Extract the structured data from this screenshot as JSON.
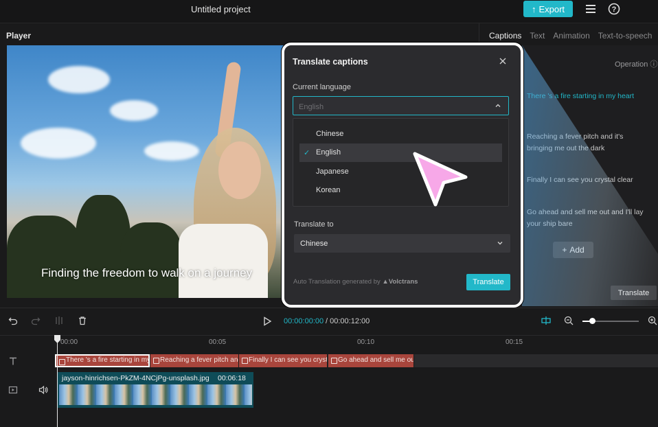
{
  "app": {
    "project_title": "Untitled project",
    "export_label": "Export",
    "colors": {
      "accent": "#22b8c9",
      "caption_clip": "#a8453c",
      "video_clip": "#0f4c58",
      "cursor": "#f7a8e8"
    }
  },
  "player": {
    "label": "Player",
    "caption_overlay": "Finding the freedom to walk on a journey"
  },
  "right_panel": {
    "tabs": [
      "Captions",
      "Text",
      "Animation",
      "Text-to-speech"
    ],
    "operation_label": "Operation",
    "captions": [
      "There 's a fire starting in my heart",
      "Reaching a fever pitch and it's bringing me out the dark",
      "Finally I can see you crystal clear",
      "Go ahead and sell me out and I'll lay your ship bare"
    ],
    "add_label": "Add",
    "translate_label": "Translate"
  },
  "modal": {
    "title": "Translate captions",
    "current_language_label": "Current language",
    "current_language_value": "English",
    "options": [
      "Chinese",
      "English",
      "Japanese",
      "Korean"
    ],
    "selected_option": "English",
    "translate_to_label": "Translate to",
    "translate_to_value": "Chinese",
    "auto_note": "Auto Translation generated by",
    "provider": "Volctrans",
    "translate_button": "Translate"
  },
  "timeline": {
    "current_time": "00:00:00:00",
    "separator": "/",
    "total_time": "00:00:12:00",
    "ruler_ticks": [
      "00:00",
      "00:05",
      "00:10",
      "00:15"
    ],
    "caption_clips": [
      "There 's a fire starting in my heart",
      "Reaching a fever pitch and it's bringing me out the dark",
      "Finally I can see you crystal clear",
      "Go ahead and sell me out and I'll lay your ship bare"
    ],
    "video_clip": {
      "name": "jayson-hinrichsen-PkZM-4NCjPg-unsplash.jpg",
      "duration": "00:06:18"
    }
  }
}
